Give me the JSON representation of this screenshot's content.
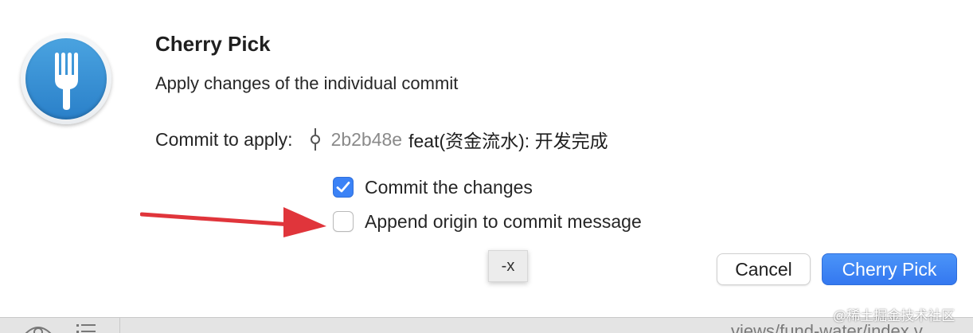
{
  "dialog": {
    "title": "Cherry Pick",
    "subtitle": "Apply changes of the individual commit",
    "commit_label": "Commit to apply:",
    "commit_hash": "2b2b48e",
    "commit_message": "feat(资金流水): 开发完成",
    "options": [
      {
        "label": "Commit the changes",
        "checked": true
      },
      {
        "label": "Append origin to commit message",
        "checked": false
      }
    ],
    "tooltip": "-x",
    "cancel_label": "Cancel",
    "confirm_label": "Cherry Pick"
  },
  "bottom_bar": {
    "path": "views/fund-water/index.v",
    "icons": [
      "eye-icon",
      "list-icon"
    ]
  },
  "watermark": "@稀土掘金技术社区",
  "colors": {
    "accent": "#3478f0",
    "annotation_arrow": "#e0353b",
    "hash_text": "#8a8a8a"
  }
}
